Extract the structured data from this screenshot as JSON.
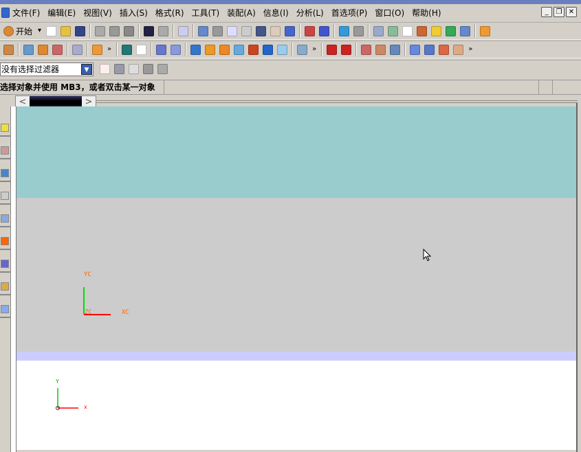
{
  "menu": [
    "文件(F)",
    "编辑(E)",
    "视图(V)",
    "插入(S)",
    "格式(R)",
    "工具(T)",
    "装配(A)",
    "信息(I)",
    "分析(L)",
    "首选项(P)",
    "窗口(O)",
    "帮助(H)"
  ],
  "window_buttons": {
    "minimize": "_",
    "restore": "❐",
    "close": "✕"
  },
  "toolbar1": {
    "start_label": "开始",
    "icons": [
      {
        "name": "new-file-icon",
        "color": "#ffffff"
      },
      {
        "name": "open-folder-icon",
        "color": "#e8c040"
      },
      {
        "name": "save-icon",
        "color": "#334488"
      },
      "sep",
      {
        "name": "cut-icon",
        "color": "#aaaaaa"
      },
      {
        "name": "copy-icon",
        "color": "#999999"
      },
      {
        "name": "paste-icon",
        "color": "#888888"
      },
      "sep",
      {
        "name": "undo-icon",
        "color": "#222244"
      },
      {
        "name": "redo-icon",
        "color": "#aaaaaa"
      },
      "sep",
      {
        "name": "info-icon",
        "color": "#ccccee"
      },
      "sep",
      {
        "name": "fit-icon",
        "color": "#6688cc"
      },
      {
        "name": "zoom-box-icon",
        "color": "#999999"
      },
      {
        "name": "zoom-window-icon",
        "color": "#ddddff"
      },
      {
        "name": "zoom-icon",
        "color": "#cccccc"
      },
      {
        "name": "rotate-icon",
        "color": "#445588"
      },
      {
        "name": "pan-icon",
        "color": "#ddccbb"
      },
      {
        "name": "perspective-icon",
        "color": "#4466cc"
      },
      "sep",
      {
        "name": "wcs-icon",
        "color": "#cc4444"
      },
      {
        "name": "wcs-orient-icon",
        "color": "#4455cc"
      },
      "sep",
      {
        "name": "shaded-cube-icon",
        "color": "#3399dd"
      },
      {
        "name": "render-style-icon",
        "color": "#999999"
      },
      "sep",
      {
        "name": "layer-icon",
        "color": "#99aacc"
      },
      {
        "name": "layer-settings-icon",
        "color": "#88bb99"
      },
      {
        "name": "selection-icon",
        "color": "#ffffff"
      },
      {
        "name": "point-constructor-icon",
        "color": "#cc6633"
      },
      {
        "name": "animation-icon",
        "color": "#eecc33"
      },
      {
        "name": "play-icon",
        "color": "#33aa55"
      },
      {
        "name": "tool-icon",
        "color": "#6688cc"
      },
      "sep",
      {
        "name": "measure-icon",
        "color": "#ee9933"
      }
    ]
  },
  "toolbar2": {
    "icons": [
      {
        "name": "assembly-icon",
        "color": "#cc8844"
      },
      "sep",
      {
        "name": "part-icon",
        "color": "#6699cc"
      },
      {
        "name": "component-icon",
        "color": "#dd8833"
      },
      {
        "name": "mate-icon",
        "color": "#cc6666"
      },
      "sep",
      {
        "name": "explode-icon",
        "color": "#aaaacc"
      },
      "sep",
      {
        "name": "sketch-icon",
        "color": "#ee9933"
      },
      "more",
      "sep",
      {
        "name": "datum-icon",
        "color": "#227777"
      },
      {
        "name": "plane-icon",
        "color": "#ffffff"
      },
      "sep",
      {
        "name": "extrude-icon",
        "color": "#6677cc"
      },
      {
        "name": "revolve-icon",
        "color": "#8899dd"
      },
      "sep",
      {
        "name": "block-icon",
        "color": "#3377cc"
      },
      {
        "name": "blend-icon",
        "color": "#ee9922"
      },
      {
        "name": "chamfer-icon",
        "color": "#ee8822"
      },
      {
        "name": "hole-icon",
        "color": "#66aadd"
      },
      {
        "name": "shell-icon",
        "color": "#cc4422"
      },
      {
        "name": "boss-icon",
        "color": "#2266cc"
      },
      {
        "name": "sphere-icon",
        "color": "#99ccee"
      },
      "sep",
      {
        "name": "pattern-icon",
        "color": "#88aacc"
      },
      "more",
      "sep",
      {
        "name": "line-icon",
        "color": "#cc2222"
      },
      {
        "name": "arc-icon",
        "color": "#cc2222"
      },
      "sep",
      {
        "name": "profile-icon",
        "color": "#cc6666"
      },
      {
        "name": "spline-icon",
        "color": "#cc8866"
      },
      {
        "name": "curve-tool-icon",
        "color": "#6688bb"
      },
      "sep",
      {
        "name": "surface-icon",
        "color": "#6688dd"
      },
      {
        "name": "mesh-surface-icon",
        "color": "#5577cc"
      },
      {
        "name": "sweep-icon",
        "color": "#dd6644"
      },
      {
        "name": "offset-surface-icon",
        "color": "#ddaa88"
      },
      "more"
    ]
  },
  "toolbar3": {
    "filter_value": "没有选择过滤器",
    "icons": [
      {
        "name": "selection-filter-icon",
        "color": "#ffeeee"
      },
      {
        "name": "undo-select-icon",
        "color": "#9999aa"
      },
      {
        "name": "eraser-icon",
        "color": "#dddddd"
      },
      {
        "name": "snap-point-icon",
        "color": "#999999"
      },
      {
        "name": "snap-angle-icon",
        "color": "#aaaaaa"
      }
    ]
  },
  "status": {
    "prompt": "选择对象并使用 MB3，或者双击某一对象"
  },
  "palette": [
    {
      "name": "assembly-navigator-icon"
    },
    {
      "name": "constraint-navigator-icon"
    },
    {
      "name": "part-navigator-icon"
    },
    {
      "name": "history-icon"
    },
    {
      "name": "reuse-library-icon"
    },
    {
      "name": "palette-color-icon"
    },
    {
      "name": "visualization-icon"
    },
    {
      "name": "roles-icon"
    },
    {
      "name": "system-scene-icon"
    }
  ],
  "viewport": {
    "colors": {
      "top": "#99cccc",
      "middle": "#cccccc",
      "band": "#ccccff",
      "bottom": "#ffffff"
    },
    "wcs": {
      "x": "XC",
      "y": "YC",
      "z": "ZC"
    },
    "absolute": {
      "x": "x",
      "y": "Y"
    }
  }
}
